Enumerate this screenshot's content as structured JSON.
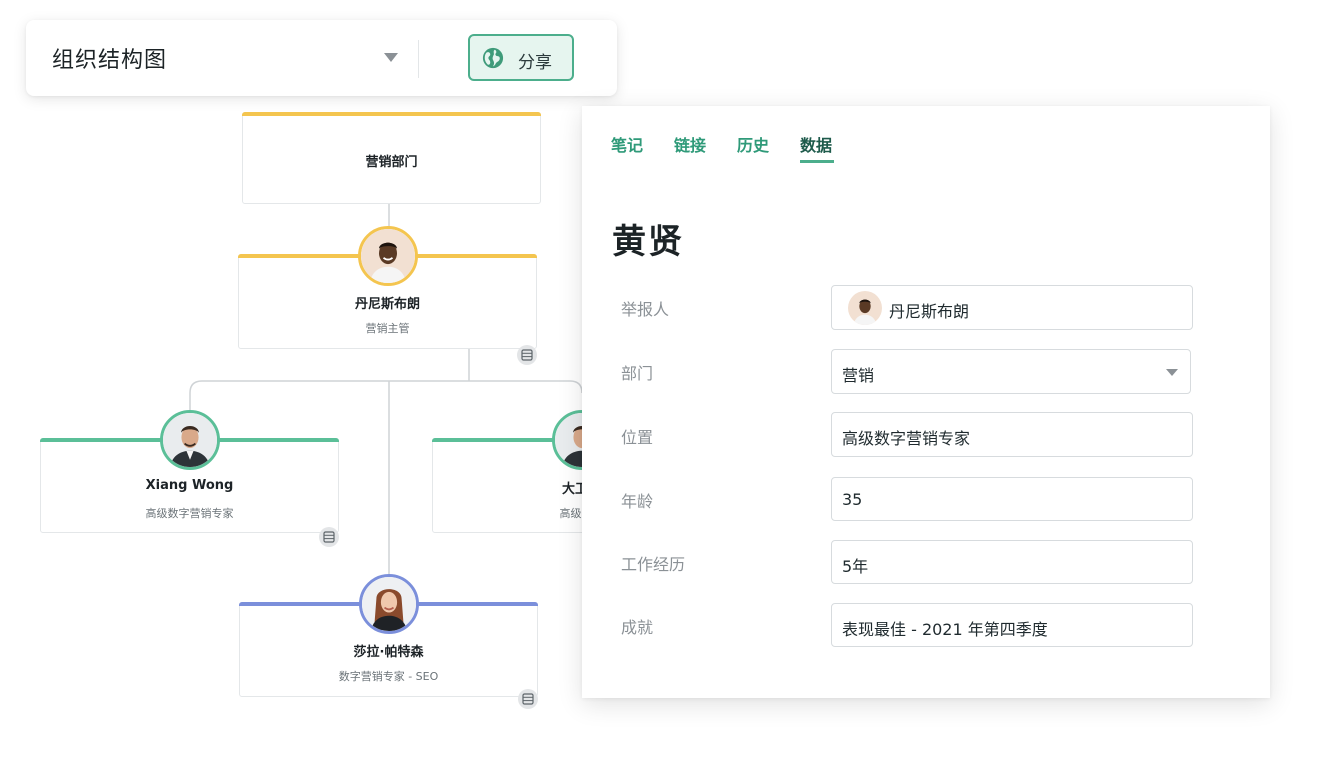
{
  "toolbar": {
    "title": "组织结构图",
    "share_label": "分享",
    "accent": "#4cae8c"
  },
  "org_chart": {
    "root": {
      "name": "营销部门",
      "bar_color": "#f4c54f"
    },
    "manager": {
      "name": "丹尼斯布朗",
      "role": "营销主管",
      "bar_color": "#f4c54f"
    },
    "left_report": {
      "name": "Xiang Wong",
      "role": "高级数字营销专家",
      "bar_color": "#5bbf98"
    },
    "right_report": {
      "name": "大卫往",
      "role": "高级数字",
      "bar_color": "#5bbf98"
    },
    "bottom_report": {
      "name": "莎拉·帕特森",
      "role": "数字营销专家 - SEO",
      "bar_color": "#7b8fdb"
    }
  },
  "details": {
    "tabs": [
      {
        "label": "笔记",
        "active": false
      },
      {
        "label": "链接",
        "active": false
      },
      {
        "label": "历史",
        "active": false
      },
      {
        "label": "数据",
        "active": true
      }
    ],
    "person_name": "黄贤",
    "fields": {
      "reporter": {
        "label": "举报人",
        "value": "丹尼斯布朗"
      },
      "department": {
        "label": "部门",
        "value": "营销"
      },
      "position": {
        "label": "位置",
        "value": "高级数字营销专家"
      },
      "age": {
        "label": "年龄",
        "value": "35"
      },
      "experience": {
        "label": "工作经历",
        "value": "5年"
      },
      "achievement": {
        "label": "成就",
        "value": "表现最佳 - 2021 年第四季度"
      }
    }
  }
}
